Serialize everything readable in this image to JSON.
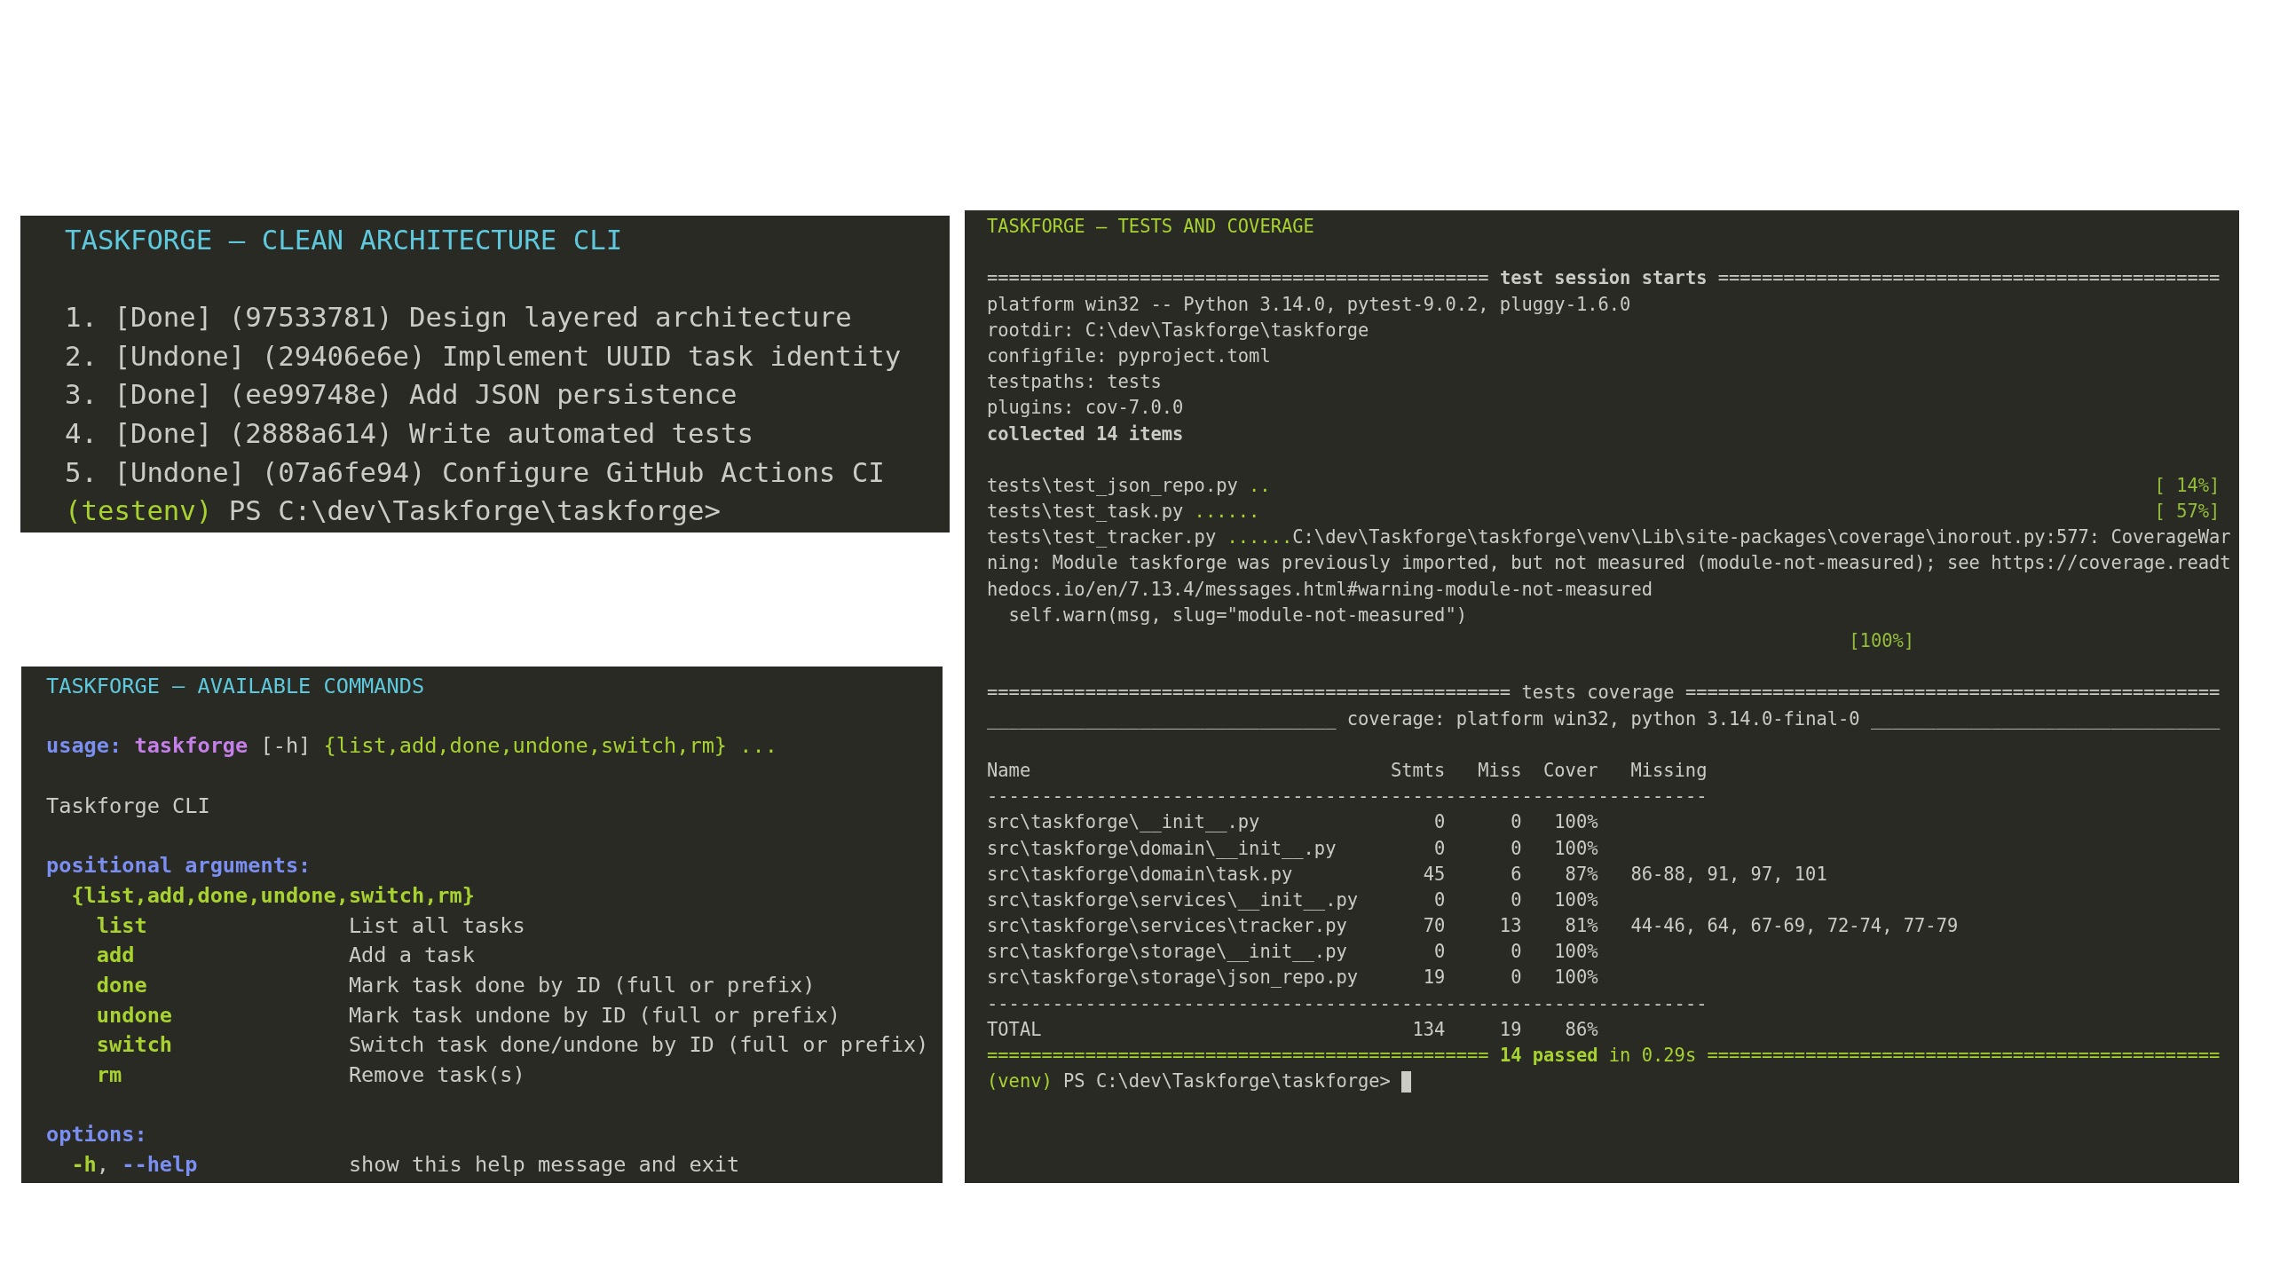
{
  "tasks_panel": {
    "title": "TASKFORGE – CLEAN ARCHITECTURE CLI",
    "tasks": [
      "1. [Done] (97533781) Design layered architecture",
      "2. [Undone] (29406e6e) Implement UUID task identity",
      "3. [Done] (ee99748e) Add JSON persistence",
      "4. [Done] (2888a614) Write automated tests",
      "5. [Undone] (07a6fe94) Configure GitHub Actions CI"
    ],
    "prompt": {
      "env": "(testenv)",
      "path": "PS C:\\dev\\Taskforge\\taskforge>"
    }
  },
  "commands_panel": {
    "title": "TASKFORGE – AVAILABLE COMMANDS",
    "usage": {
      "label": "usage:",
      "prog": "taskforge",
      "option": "[-h]",
      "positional": "{list,add,done,undone,switch,rm} ..."
    },
    "description": "Taskforge CLI",
    "positional": {
      "heading": "positional arguments:",
      "choices": "{list,add,done,undone,switch,rm}",
      "commands": [
        {
          "name": "list",
          "help": "List all tasks"
        },
        {
          "name": "add",
          "help": "Add a task"
        },
        {
          "name": "done",
          "help": "Mark task done by ID (full or prefix)"
        },
        {
          "name": "undone",
          "help": "Mark task undone by ID (full or prefix)"
        },
        {
          "name": "switch",
          "help": "Switch task done/undone by ID (full or prefix)"
        },
        {
          "name": "rm",
          "help": "Remove task(s)"
        }
      ]
    },
    "options": {
      "heading": "options:",
      "items": [
        {
          "short": "-h",
          "separator": ",",
          "long": "--help",
          "help": "show this help message and exit"
        }
      ]
    }
  },
  "tests_panel": {
    "title": "TASKFORGE – TESTS AND COVERAGE",
    "session_header": "============================================== **test session starts** ==============================================",
    "session_info": [
      "platform win32 -- Python 3.14.0, pytest-9.0.2, pluggy-1.6.0",
      "rootdir: C:\\dev\\Taskforge\\taskforge",
      "configfile: pyproject.toml",
      "testpaths: tests",
      "plugins: cov-7.0.0"
    ],
    "collected": "collected 14 items",
    "progress": [
      {
        "file": "tests\\test_json_repo.py",
        "dots": "..",
        "percent": "[ 14%]"
      },
      {
        "file": "tests\\test_task.py",
        "dots": "......",
        "percent": "[ 57%]"
      },
      {
        "file": "tests\\test_tracker.py",
        "dots": "......",
        "output": "C:\\dev\\Taskforge\\taskforge\\venv\\Lib\\site-packages\\coverage\\inorout.py:577: CoverageWar"
      }
    ],
    "warning_lines": [
      "ning: Module taskforge was previously imported, but not measured (module-not-measured); see https://coverage.readt",
      "hedocs.io/en/7.13.4/messages.html#warning-module-not-measured"
    ],
    "warning_source": "self.warn(msg, slug=\"module-not-measured\")",
    "final_percent": "[100%]",
    "coverage_header": "================================================ tests coverage =================================================",
    "coverage_platform": "________________________________ coverage: platform win32, python 3.14.0-final-0 ________________________________",
    "table": {
      "columns": [
        "Name",
        "Stmts",
        "Miss",
        "Cover",
        "Missing"
      ],
      "header_rule": "------------------------------------------------------------------",
      "rows": [
        [
          "src\\taskforge\\__init__.py",
          "0",
          "0",
          "100%"
        ],
        [
          "src\\taskforge\\domain\\__init__.py",
          "0",
          "0",
          "100%"
        ],
        [
          "src\\taskforge\\domain\\task.py",
          "45",
          "6",
          "87%",
          "86-88, 91, 97, 101"
        ],
        [
          "src\\taskforge\\services\\__init__.py",
          "0",
          "0",
          "100%"
        ],
        [
          "src\\taskforge\\services\\tracker.py",
          "70",
          "13",
          "81%",
          "44-46, 64, 67-69, 72-74, 77-79"
        ],
        [
          "src\\taskforge\\storage\\__init__.py",
          "0",
          "0",
          "100%"
        ],
        [
          "src\\taskforge\\storage\\json_repo.py",
          "19",
          "0",
          "100%"
        ]
      ],
      "total_rule": "------------------------------------------------------------------",
      "total": [
        "TOTAL",
        "134",
        "19",
        "86%"
      ]
    },
    "result": "============================================== **14 passed** in 0.29s ===============================================",
    "prompt": {
      "env": "(venv)",
      "path": "PS C:\\dev\\Taskforge\\taskforge>"
    }
  }
}
